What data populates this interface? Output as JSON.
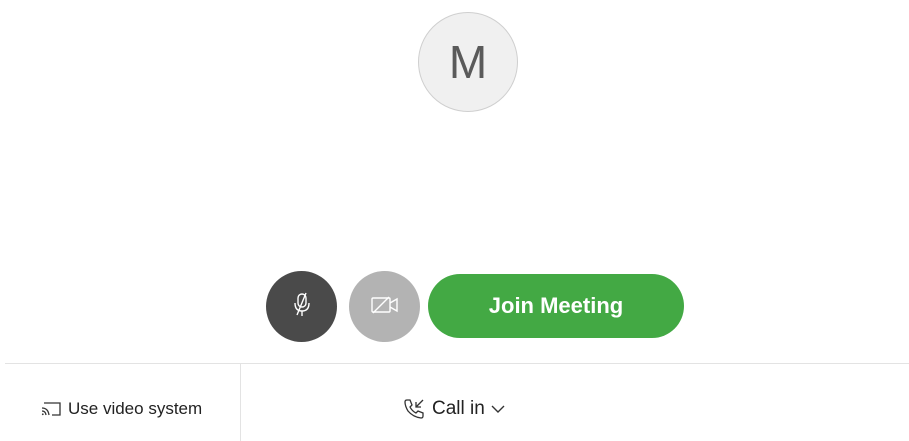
{
  "avatar": {
    "initial": "M"
  },
  "controls": {
    "mute_icon": "microphone-muted-icon",
    "video_icon": "video-off-icon",
    "join_label": "Join Meeting"
  },
  "footer": {
    "video_system_label": "Use video system",
    "video_system_icon": "cast-screen-icon",
    "call_in_label": "Call in",
    "call_in_icon": "phone-incoming-icon",
    "call_in_chevron": "chevron-down-icon"
  },
  "colors": {
    "join_green": "#43a944",
    "mute_dark": "#4a4a4a",
    "video_grey": "#b3b3b3",
    "avatar_bg": "#f0f0f0"
  }
}
